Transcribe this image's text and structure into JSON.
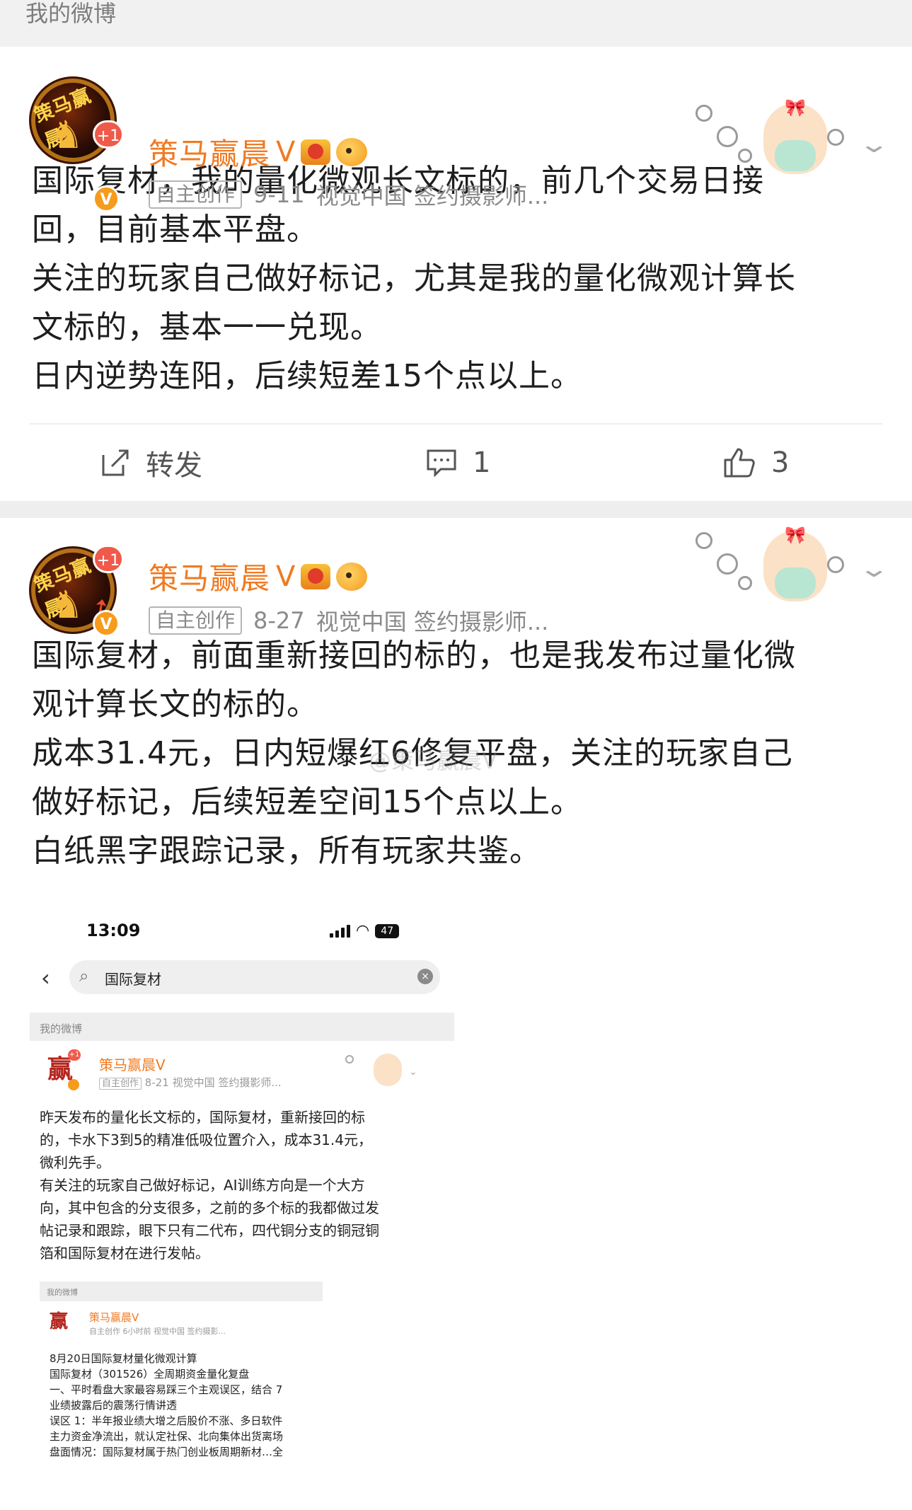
{
  "section_header": "我的微博",
  "posts": [
    {
      "avatar_text": "策马赢晨",
      "plus_badge": "+1",
      "name": "策马赢晨",
      "verified_mark": "V",
      "tag": "自主创作",
      "date": "9-11",
      "source": "视觉中国 签约摄影师...",
      "lines": [
        "国际复材，我的量化微观长文标的，前几个交易日接",
        "回，目前基本平盘。",
        "关注的玩家自己做好标记，尤其是我的量化微观计算长",
        "文标的，基本一一兑现。",
        "日内逆势连阳，后续短差15个点以上。"
      ],
      "actions": {
        "repost": "转发",
        "comments": "1",
        "likes": "3"
      }
    },
    {
      "avatar_text": "策马赢晨",
      "plus_badge": "+1",
      "name": "策马赢晨",
      "verified_mark": "V",
      "tag": "自主创作",
      "date": "8-27",
      "source": "视觉中国 签约摄影师...",
      "lines": [
        "国际复材，前面重新接回的标的，也是我发布过量化微",
        "观计算长文的标的。",
        "成本31.4元，日内短爆红6修复平盘，关注的玩家自己",
        "做好标记，后续短差空间15个点以上。",
        "白纸黑字跟踪记录，所有玩家共鉴。"
      ],
      "watermark": "@策马赢晨V"
    }
  ],
  "embedded": {
    "time": "13:09",
    "battery": "47",
    "search_query": "国际复材",
    "section": "我的微博",
    "avatar_char": "赢",
    "name": "策马赢晨V",
    "tag": "自主创作",
    "meta": "8-21 视觉中国 签约摄影师...",
    "lines": [
      "昨天发布的量化长文标的，国际复材，重新接回的标",
      "的，卡水下3到5的精准低吸位置介入，成本31.4元，",
      "微利先手。",
      "有关注的玩家自己做好标记，AI训练方向是一个大方",
      "向，其中包含的分支很多，之前的多个标的我都做过发",
      "帖记录和跟踪，眼下只有二代布，四代铜分支的铜冠铜",
      "箔和国际复材在进行发帖。"
    ],
    "nested": {
      "section": "我的微博",
      "avatar_char": "赢",
      "name": "策马赢晨V",
      "meta": "自主创作 6小时前 视觉中国 签约摄影...",
      "lines": [
        "8月20日国际复材量化微观计算",
        "国际复材（301526）全周期资金量化复盘",
        "一、平时看盘大家最容易踩三个主观误区，结合 7",
        "业绩披露后的震荡行情讲透",
        "误区 1：半年报业绩大增之后股价不涨、多日软件",
        "主力资金净流出，就认定社保、北向集体出货离场",
        "盘面情况：国际复材属于热门创业板周期新材…全"
      ]
    }
  },
  "colors": {
    "accent": "#f07a22",
    "text": "#1e1e1e",
    "meta": "#8a8a8a"
  }
}
